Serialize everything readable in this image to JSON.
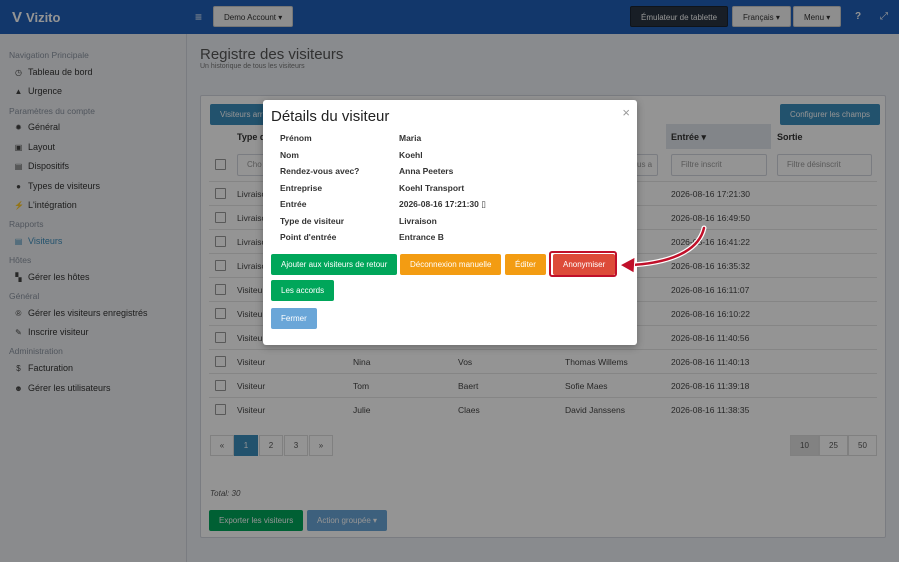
{
  "app": {
    "name": "Vizito"
  },
  "topbar": {
    "account": "Demo Account ▾",
    "emulator": "Émulateur de tablette",
    "language": "Français ▾",
    "menu": "Menu ▾",
    "help_icon": "?",
    "expand_icon": "⤢"
  },
  "sidebar": {
    "sections": [
      {
        "header": "Navigation Principale",
        "items": [
          {
            "label": "Tableau de bord",
            "icon": "dashboard-icon"
          },
          {
            "label": "Urgence",
            "icon": "warning-icon"
          }
        ]
      },
      {
        "header": "Paramètres du compte",
        "items": [
          {
            "label": "Général",
            "icon": "gear-icon"
          },
          {
            "label": "Layout",
            "icon": "image-icon"
          },
          {
            "label": "Dispositifs",
            "icon": "devices-icon"
          },
          {
            "label": "Types de visiteurs",
            "icon": "users-icon"
          },
          {
            "label": "L'intégration",
            "icon": "plug-icon"
          }
        ]
      },
      {
        "header": "Rapports",
        "items": [
          {
            "label": "Visiteurs",
            "icon": "list-icon",
            "active": true
          }
        ]
      },
      {
        "header": "Hôtes",
        "items": [
          {
            "label": "Gérer les hôtes",
            "icon": "hosts-icon"
          }
        ]
      },
      {
        "header": "Général",
        "items": [
          {
            "label": "Gérer les visiteurs enregistrés",
            "icon": "registered-icon"
          },
          {
            "label": "Inscrire visiteur",
            "icon": "pen-icon"
          }
        ]
      },
      {
        "header": "Administration",
        "items": [
          {
            "label": "Facturation",
            "icon": "dollar-icon"
          },
          {
            "label": "Gérer les utilisateurs",
            "icon": "user-plus-icon"
          }
        ]
      }
    ]
  },
  "page": {
    "title": "Registre des visiteurs",
    "subtitle": "Un historique de tous les visiteurs"
  },
  "toolbar": {
    "visitors_btn": "Visiteurs arri",
    "configure_btn": "Configurer les champs"
  },
  "table": {
    "headers": {
      "type": "Type d",
      "entry": "Entrée",
      "exit": "Sortie"
    },
    "filters": {
      "type": "Cho",
      "partial": "us a",
      "entry": "Filtre inscrit",
      "exit": "Filtre désinscrit"
    },
    "rows": [
      {
        "type": "Livraiso",
        "first": "",
        "last": "",
        "host": "",
        "entry": "2026-08-16 17:21:30"
      },
      {
        "type": "Livraiso",
        "first": "",
        "last": "",
        "host": "",
        "entry": "2026-08-16 16:49:50"
      },
      {
        "type": "Livraiso",
        "first": "",
        "last": "",
        "host": "",
        "entry": "2026-08-16 16:41:22"
      },
      {
        "type": "Livraiso",
        "first": "",
        "last": "",
        "host": "",
        "entry": "2026-08-16 16:35:32"
      },
      {
        "type": "Visiteu",
        "first": "",
        "last": "",
        "host": "",
        "entry": "2026-08-16 16:11:07"
      },
      {
        "type": "Visiteu",
        "first": "",
        "last": "",
        "host": "",
        "entry": "2026-08-16 16:10:22"
      },
      {
        "type": "Visiteu",
        "first": "",
        "last": "",
        "host": "",
        "entry": "2026-08-16 11:40:56"
      },
      {
        "type": "Visiteur",
        "first": "Nina",
        "last": "Vos",
        "host": "Thomas Willems",
        "entry": "2026-08-16 11:40:13"
      },
      {
        "type": "Visiteur",
        "first": "Tom",
        "last": "Baert",
        "host": "Sofie Maes",
        "entry": "2026-08-16 11:39:18"
      },
      {
        "type": "Visiteur",
        "first": "Julie",
        "last": "Claes",
        "host": "David Janssens",
        "entry": "2026-08-16 11:38:35"
      }
    ]
  },
  "pagination": {
    "prev": "«",
    "pages": [
      "1",
      "2",
      "3"
    ],
    "next": "»",
    "current": "1",
    "sizes": [
      "10",
      "25",
      "50"
    ],
    "current_size": "10"
  },
  "footer": {
    "total": "Total: 30",
    "export_btn": "Exporter les visiteurs",
    "group_action_btn": "Action groupée ▾"
  },
  "modal": {
    "title": "Détails du visiteur",
    "close": "×",
    "fields": [
      {
        "label": "Prénom",
        "value": "Maria"
      },
      {
        "label": "Nom",
        "value": "Koehl"
      },
      {
        "label": "Rendez-vous avec?",
        "value": "Anna Peeters"
      },
      {
        "label": "Entreprise",
        "value": "Koehl Transport"
      },
      {
        "label": "Entrée",
        "value": "2026-08-16 17:21:30"
      },
      {
        "label": "Type de visiteur",
        "value": "Livraison"
      },
      {
        "label": "Point d'entrée",
        "value": "Entrance B"
      }
    ],
    "buttons": {
      "add_return": "Ajouter aux visiteurs de retour",
      "manual_logout": "Déconnexion manuelle",
      "edit": "Éditer",
      "anonymize": "Anonymiser",
      "agreements": "Les accords",
      "close": "Fermer"
    }
  },
  "colors": {
    "topbar": "#1f5fb8",
    "primary": "#3c8dbc",
    "success": "#00a65a",
    "warning": "#f39c12",
    "danger": "#dd4b39",
    "annotation": "#c0102a"
  }
}
